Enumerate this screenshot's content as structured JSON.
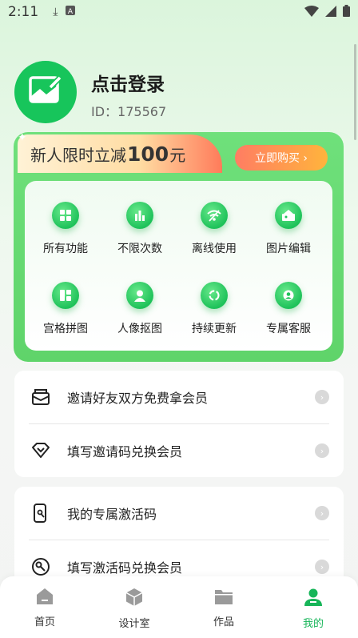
{
  "status_bar": {
    "time": "2:11"
  },
  "profile": {
    "title": "点击登录",
    "id_text": "ID：175567"
  },
  "vip": {
    "banner_prefix": "新人限时立减",
    "banner_amount": "100",
    "banner_suffix": "元",
    "buy_label": "立即购买 ›",
    "features": [
      {
        "label": "所有功能",
        "icon": "grid-icon"
      },
      {
        "label": "不限次数",
        "icon": "bar-chart-icon"
      },
      {
        "label": "离线使用",
        "icon": "wifi-off-icon"
      },
      {
        "label": "图片编辑",
        "icon": "image-edit-icon"
      },
      {
        "label": "宫格拼图",
        "icon": "collage-icon"
      },
      {
        "label": "人像抠图",
        "icon": "portrait-icon"
      },
      {
        "label": "持续更新",
        "icon": "refresh-icon"
      },
      {
        "label": "专属客服",
        "icon": "support-icon"
      }
    ]
  },
  "menu_group_1": [
    {
      "label": "邀请好友双方免费拿会员",
      "icon": "envelope-icon"
    },
    {
      "label": "填写邀请码兑换会员",
      "icon": "diamond-icon"
    }
  ],
  "menu_group_2": [
    {
      "label": "我的专属激活码",
      "icon": "phone-key-icon"
    },
    {
      "label": "填写激活码兑换会员",
      "icon": "key-icon"
    }
  ],
  "bottom_nav": [
    {
      "label": "首页",
      "icon": "home-icon"
    },
    {
      "label": "设计室",
      "icon": "cube-icon"
    },
    {
      "label": "作品",
      "icon": "folder-icon"
    },
    {
      "label": "我的",
      "icon": "user-icon"
    }
  ],
  "colors": {
    "accent": "#17b559",
    "card_green": "#5fd46a",
    "buy_button": "#ff9a4a"
  }
}
